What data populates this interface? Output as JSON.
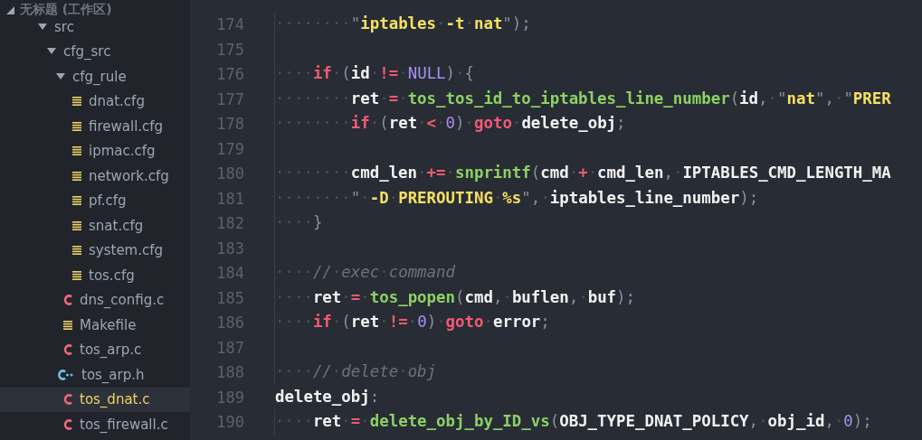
{
  "sidebar": {
    "workspace": {
      "label": "无标题 (工作区)",
      "expanded": true
    },
    "tree": [
      {
        "name": "src",
        "expanded": true,
        "children": [
          {
            "name": "cfg_src",
            "expanded": true,
            "children": [
              {
                "name": "cfg_rule",
                "expanded": true,
                "children": [
                  {
                    "name": "dnat.cfg",
                    "kind": "cfg",
                    "selected": false
                  },
                  {
                    "name": "firewall.cfg",
                    "kind": "cfg",
                    "selected": false
                  },
                  {
                    "name": "ipmac.cfg",
                    "kind": "cfg",
                    "selected": false
                  },
                  {
                    "name": "network.cfg",
                    "kind": "cfg",
                    "selected": false
                  },
                  {
                    "name": "pf.cfg",
                    "kind": "cfg",
                    "selected": false
                  },
                  {
                    "name": "snat.cfg",
                    "kind": "cfg",
                    "selected": false
                  },
                  {
                    "name": "system.cfg",
                    "kind": "cfg",
                    "selected": false
                  },
                  {
                    "name": "tos.cfg",
                    "kind": "cfg",
                    "selected": false
                  }
                ]
              },
              {
                "name": "dns_config.c",
                "kind": "c",
                "selected": false
              },
              {
                "name": "Makefile",
                "kind": "cfg",
                "selected": false
              },
              {
                "name": "tos_arp.c",
                "kind": "c",
                "selected": false
              },
              {
                "name": "tos_arp.h",
                "kind": "h",
                "selected": false
              },
              {
                "name": "tos_dnat.c",
                "kind": "c",
                "selected": true
              },
              {
                "name": "tos_firewall.c",
                "kind": "c",
                "selected": false
              }
            ]
          }
        ]
      }
    ]
  },
  "editor": {
    "lines": [
      {
        "number": "174",
        "tokens": [
          {
            "kind": "ws",
            "text": "········"
          },
          {
            "kind": "punct",
            "text": "\""
          },
          {
            "kind": "str",
            "text": "iptables"
          },
          {
            "kind": "ws",
            "text": "·"
          },
          {
            "kind": "str",
            "text": "-t"
          },
          {
            "kind": "ws",
            "text": "·"
          },
          {
            "kind": "str",
            "text": "nat"
          },
          {
            "kind": "punct",
            "text": "\");"
          }
        ]
      },
      {
        "number": "175"
      },
      {
        "number": "176",
        "tokens": [
          {
            "kind": "ws",
            "text": "····"
          },
          {
            "kind": "kw",
            "text": "if"
          },
          {
            "kind": "ws",
            "text": "·"
          },
          {
            "kind": "punct",
            "text": "("
          },
          {
            "kind": "plain",
            "text": "id"
          },
          {
            "kind": "ws",
            "text": "·"
          },
          {
            "kind": "op",
            "text": "!="
          },
          {
            "kind": "ws",
            "text": "·"
          },
          {
            "kind": "num",
            "text": "NULL"
          },
          {
            "kind": "punct",
            "text": ")"
          },
          {
            "kind": "ws",
            "text": "·"
          },
          {
            "kind": "punct",
            "text": "{"
          }
        ]
      },
      {
        "number": "177",
        "tokens": [
          {
            "kind": "ws",
            "text": "········"
          },
          {
            "kind": "plain",
            "text": "ret"
          },
          {
            "kind": "ws",
            "text": "·"
          },
          {
            "kind": "op",
            "text": "="
          },
          {
            "kind": "ws",
            "text": "·"
          },
          {
            "kind": "fn",
            "text": "tos_tos_id_to_iptables_line_number"
          },
          {
            "kind": "punct",
            "text": "("
          },
          {
            "kind": "plain",
            "text": "id"
          },
          {
            "kind": "punct",
            "text": ","
          },
          {
            "kind": "ws",
            "text": "·"
          },
          {
            "kind": "punct",
            "text": "\""
          },
          {
            "kind": "str",
            "text": "nat"
          },
          {
            "kind": "punct",
            "text": "\","
          },
          {
            "kind": "ws",
            "text": "·"
          },
          {
            "kind": "punct",
            "text": "\""
          },
          {
            "kind": "str",
            "text": "PRER"
          }
        ]
      },
      {
        "number": "178",
        "tokens": [
          {
            "kind": "ws",
            "text": "········"
          },
          {
            "kind": "kw",
            "text": "if"
          },
          {
            "kind": "ws",
            "text": "·"
          },
          {
            "kind": "punct",
            "text": "("
          },
          {
            "kind": "plain",
            "text": "ret"
          },
          {
            "kind": "ws",
            "text": "·"
          },
          {
            "kind": "op",
            "text": "<"
          },
          {
            "kind": "ws",
            "text": "·"
          },
          {
            "kind": "num",
            "text": "0"
          },
          {
            "kind": "punct",
            "text": ")"
          },
          {
            "kind": "ws",
            "text": "·"
          },
          {
            "kind": "kw",
            "text": "goto"
          },
          {
            "kind": "ws",
            "text": "·"
          },
          {
            "kind": "plain",
            "text": "delete_obj"
          },
          {
            "kind": "punct",
            "text": ";"
          }
        ]
      },
      {
        "number": "179"
      },
      {
        "number": "180",
        "tokens": [
          {
            "kind": "ws",
            "text": "········"
          },
          {
            "kind": "plain",
            "text": "cmd_len"
          },
          {
            "kind": "ws",
            "text": "·"
          },
          {
            "kind": "op",
            "text": "+="
          },
          {
            "kind": "ws",
            "text": "·"
          },
          {
            "kind": "fn",
            "text": "snprintf"
          },
          {
            "kind": "punct",
            "text": "("
          },
          {
            "kind": "plain",
            "text": "cmd"
          },
          {
            "kind": "ws",
            "text": "·"
          },
          {
            "kind": "op",
            "text": "+"
          },
          {
            "kind": "ws",
            "text": "·"
          },
          {
            "kind": "plain",
            "text": "cmd_len"
          },
          {
            "kind": "punct",
            "text": ","
          },
          {
            "kind": "ws",
            "text": "·"
          },
          {
            "kind": "plain",
            "text": "IPTABLES_CMD_LENGTH_MA"
          }
        ]
      },
      {
        "number": "181",
        "tokens": [
          {
            "kind": "ws",
            "text": "········"
          },
          {
            "kind": "punct",
            "text": "\""
          },
          {
            "kind": "ws",
            "text": "·"
          },
          {
            "kind": "str",
            "text": "-D"
          },
          {
            "kind": "ws",
            "text": "·"
          },
          {
            "kind": "str",
            "text": "PREROUTING"
          },
          {
            "kind": "ws",
            "text": "·"
          },
          {
            "kind": "str",
            "text": "%s"
          },
          {
            "kind": "punct",
            "text": "\","
          },
          {
            "kind": "ws",
            "text": "·"
          },
          {
            "kind": "plain",
            "text": "iptables_line_number"
          },
          {
            "kind": "punct",
            "text": ");"
          }
        ]
      },
      {
        "number": "182",
        "tokens": [
          {
            "kind": "ws",
            "text": "····"
          },
          {
            "kind": "punct",
            "text": "}"
          }
        ]
      },
      {
        "number": "183"
      },
      {
        "number": "184",
        "tokens": [
          {
            "kind": "ws",
            "text": "····"
          },
          {
            "kind": "comment",
            "text": "//"
          },
          {
            "kind": "ws",
            "text": "·"
          },
          {
            "kind": "comment",
            "text": "exec"
          },
          {
            "kind": "ws",
            "text": "·"
          },
          {
            "kind": "comment",
            "text": "command"
          }
        ]
      },
      {
        "number": "185",
        "tokens": [
          {
            "kind": "ws",
            "text": "····"
          },
          {
            "kind": "plain",
            "text": "ret"
          },
          {
            "kind": "ws",
            "text": "·"
          },
          {
            "kind": "op",
            "text": "="
          },
          {
            "kind": "ws",
            "text": "·"
          },
          {
            "kind": "fn",
            "text": "tos_popen"
          },
          {
            "kind": "punct",
            "text": "("
          },
          {
            "kind": "plain",
            "text": "cmd"
          },
          {
            "kind": "punct",
            "text": ","
          },
          {
            "kind": "ws",
            "text": "·"
          },
          {
            "kind": "plain",
            "text": "buflen"
          },
          {
            "kind": "punct",
            "text": ","
          },
          {
            "kind": "ws",
            "text": "·"
          },
          {
            "kind": "plain",
            "text": "buf"
          },
          {
            "kind": "punct",
            "text": ");"
          }
        ]
      },
      {
        "number": "186",
        "tokens": [
          {
            "kind": "ws",
            "text": "····"
          },
          {
            "kind": "kw",
            "text": "if"
          },
          {
            "kind": "ws",
            "text": "·"
          },
          {
            "kind": "punct",
            "text": "("
          },
          {
            "kind": "plain",
            "text": "ret"
          },
          {
            "kind": "ws",
            "text": "·"
          },
          {
            "kind": "op",
            "text": "!="
          },
          {
            "kind": "ws",
            "text": "·"
          },
          {
            "kind": "num",
            "text": "0"
          },
          {
            "kind": "punct",
            "text": ")"
          },
          {
            "kind": "ws",
            "text": "·"
          },
          {
            "kind": "kw",
            "text": "goto"
          },
          {
            "kind": "ws",
            "text": "·"
          },
          {
            "kind": "plain",
            "text": "error"
          },
          {
            "kind": "punct",
            "text": ";"
          }
        ]
      },
      {
        "number": "187"
      },
      {
        "number": "188",
        "tokens": [
          {
            "kind": "ws",
            "text": "····"
          },
          {
            "kind": "comment",
            "text": "//"
          },
          {
            "kind": "ws",
            "text": "·"
          },
          {
            "kind": "comment",
            "text": "delete"
          },
          {
            "kind": "ws",
            "text": "·"
          },
          {
            "kind": "comment",
            "text": "obj"
          }
        ]
      },
      {
        "number": "189",
        "tokens": [
          {
            "kind": "plain",
            "text": "delete_obj"
          },
          {
            "kind": "punct",
            "text": ":"
          }
        ]
      },
      {
        "number": "190",
        "tokens": [
          {
            "kind": "ws",
            "text": "····"
          },
          {
            "kind": "plain",
            "text": "ret"
          },
          {
            "kind": "ws",
            "text": "·"
          },
          {
            "kind": "op",
            "text": "="
          },
          {
            "kind": "ws",
            "text": "·"
          },
          {
            "kind": "fn",
            "text": "delete_obj_by_ID_vs"
          },
          {
            "kind": "punct",
            "text": "("
          },
          {
            "kind": "plain",
            "text": "OBJ_TYPE_DNAT_POLICY"
          },
          {
            "kind": "punct",
            "text": ","
          },
          {
            "kind": "ws",
            "text": "·"
          },
          {
            "kind": "plain",
            "text": "obj_id"
          },
          {
            "kind": "punct",
            "text": ","
          },
          {
            "kind": "ws",
            "text": "·"
          },
          {
            "kind": "num",
            "text": "0"
          },
          {
            "kind": "punct",
            "text": ");"
          }
        ]
      }
    ]
  }
}
